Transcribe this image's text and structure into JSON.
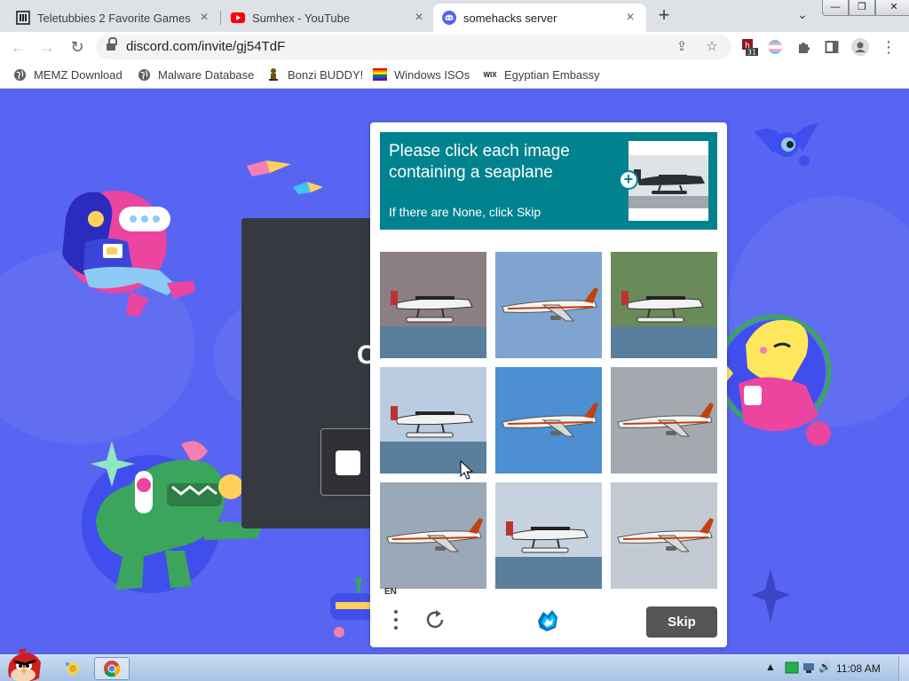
{
  "tabs": [
    {
      "title": "Teletubbies 2 Favorite Games",
      "icon": "library-icon",
      "active": false
    },
    {
      "title": "Sumhex - YouTube",
      "icon": "youtube-icon",
      "active": false
    },
    {
      "title": "somehacks server",
      "icon": "discord-icon",
      "active": true
    }
  ],
  "window_controls": {
    "minimize": "—",
    "restore": "❐",
    "close": "✕"
  },
  "toolbar": {
    "url": "discord.com/invite/gj54TdF",
    "extension_badge": "31"
  },
  "bookmarks": [
    {
      "label": "MEMZ Download",
      "icon": "globe-icon"
    },
    {
      "label": "Malware Database",
      "icon": "globe-icon"
    },
    {
      "label": "Bonzi BUDDY!",
      "icon": "bonzi-icon"
    },
    {
      "label": "Windows ISOs",
      "icon": "rainbow-flag-icon"
    },
    {
      "label": "Egyptian Embassy",
      "icon": "wix-icon",
      "icon_text": "WIX"
    }
  ],
  "invite": {
    "partial_letter": "C"
  },
  "captcha": {
    "prompt": "Please click each image containing a seaplane",
    "subprompt": "If there are None, click Skip",
    "language": "EN",
    "skip_label": "Skip",
    "grid": [
      {
        "subject": "seaplane",
        "sky": "#8b7f84"
      },
      {
        "subject": "airliner",
        "sky": "#7fa4d0"
      },
      {
        "subject": "seaplane",
        "sky": "#6b8a5a"
      },
      {
        "subject": "seaplane",
        "sky": "#b9cbe0"
      },
      {
        "subject": "airliner",
        "sky": "#4d8fd0"
      },
      {
        "subject": "airliner",
        "sky": "#a4a9b0"
      },
      {
        "subject": "airliner",
        "sky": "#9aa8b8"
      },
      {
        "subject": "seaplane",
        "sky": "#c6d2de"
      },
      {
        "subject": "airliner",
        "sky": "#c2c9d2"
      }
    ]
  },
  "taskbar": {
    "clock": "11:08 AM"
  },
  "colors": {
    "discord_blurple": "#5865f2",
    "captcha_teal": "#00838f",
    "skip_gray": "#555555"
  }
}
